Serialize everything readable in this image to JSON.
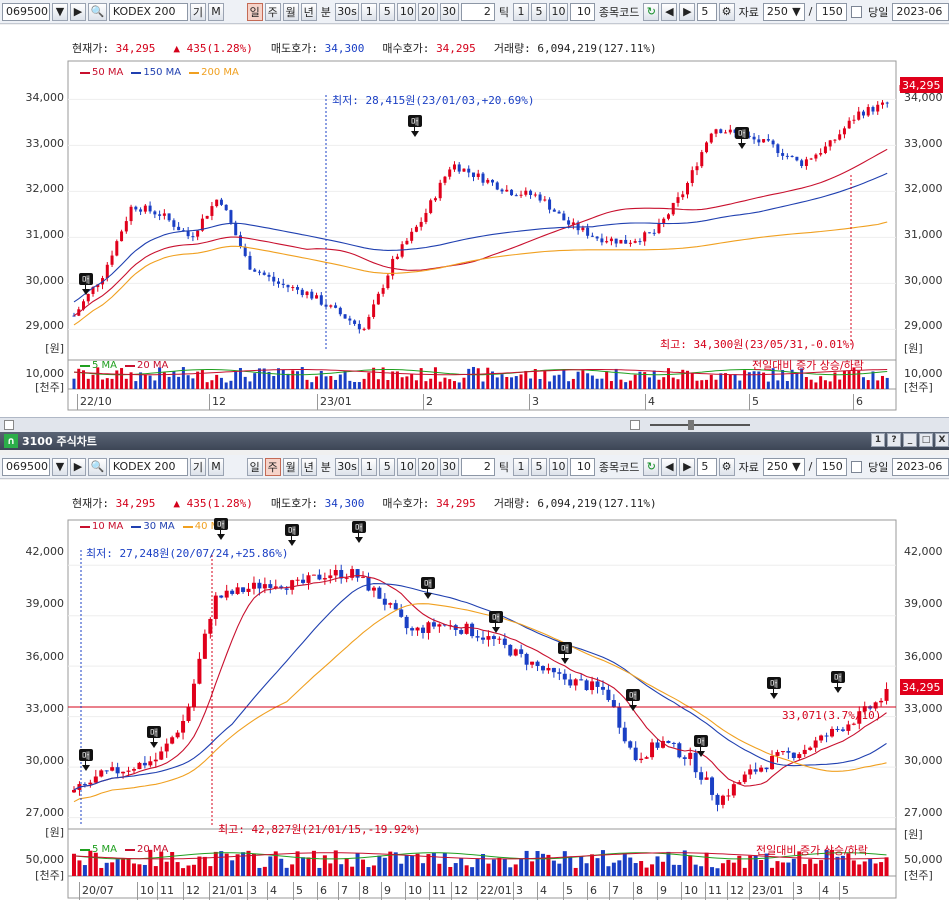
{
  "toolbar1": {
    "code": "069500",
    "name": "KODEX 200",
    "gi": "기",
    "m": "M",
    "periods": [
      "일",
      "주",
      "월",
      "년"
    ],
    "bun": "분",
    "s30": "30s",
    "mins": [
      "1",
      "5",
      "10",
      "20",
      "30"
    ],
    "tick_val": "2",
    "tick": "틱",
    "ticks": [
      "1",
      "5",
      "10"
    ],
    "ten": "10",
    "code_label": "종목코드",
    "step": "5",
    "data_label": "자료",
    "count": "250",
    "slash": "/",
    "total": "150",
    "today": "당일",
    "date": "2023-06"
  },
  "info": {
    "price_label": "현재가:",
    "price": "34,295",
    "change": "▲ 435(1.28%)",
    "ask_label": "매도호가:",
    "ask": "34,300",
    "bid_label": "매수호가:",
    "bid": "34,295",
    "vol_label": "거래량:",
    "vol": "6,094,219(127.11%)"
  },
  "chart1": {
    "legend": [
      "50 MA",
      "150 MA",
      "200 MA"
    ],
    "low_note": "최저: 28,415원(23/01/03,+20.69%)",
    "high_note": "최고: 34,300원(23/05/31,-0.01%)",
    "price_tag": "34,295",
    "won": "[원]",
    "yticks": [
      "34,000",
      "33,000",
      "32,000",
      "31,000",
      "30,000",
      "29,000"
    ],
    "vol_legend": [
      "5 MA",
      "20 MA"
    ],
    "vol_ytick": "10,000",
    "vol_unit": "[천주]",
    "vol_note": "전일대비 증가 상승/하락",
    "xticks": [
      "22/10",
      "12",
      "23/01",
      "2",
      "3",
      "4",
      "5",
      "6"
    ]
  },
  "window": {
    "title": "3100 주식차트",
    "buttons": [
      "1",
      "?",
      "_",
      "□",
      "X"
    ]
  },
  "chart2": {
    "legend": [
      "10 MA",
      "30 MA",
      "40 MA"
    ],
    "low_note": "최저: 27,248원(20/07/24,+25.86%)",
    "high_note": "최고: 42,827원(21/01/15,-19.92%)",
    "mid_note": "33,071(3.7%/10)",
    "price_tag": "34,295",
    "won": "[원]",
    "yticks": [
      "42,000",
      "39,000",
      "36,000",
      "33,000",
      "30,000",
      "27,000"
    ],
    "vol_legend": [
      "5 MA",
      "20 MA"
    ],
    "vol_ytick": "50,000",
    "vol_unit": "[천주]",
    "vol_note": "전일대비 증가 상승/하락",
    "xticks": [
      "20/07",
      "10",
      "11",
      "12",
      "21/01",
      "3",
      "4",
      "5",
      "6",
      "7",
      "8",
      "9",
      "10",
      "11",
      "12",
      "22/01",
      "3",
      "4",
      "5",
      "6",
      "7",
      "8",
      "9",
      "10",
      "11",
      "12",
      "23/01",
      "3",
      "4",
      "5"
    ]
  },
  "flag_label": "매",
  "colors": {
    "up": "#e0001b",
    "down": "#1a3fc4",
    "ma_red": "#c8102e",
    "ma_blue": "#2040b0",
    "ma_orange": "#f0a020",
    "ma_green": "#20a020"
  }
}
